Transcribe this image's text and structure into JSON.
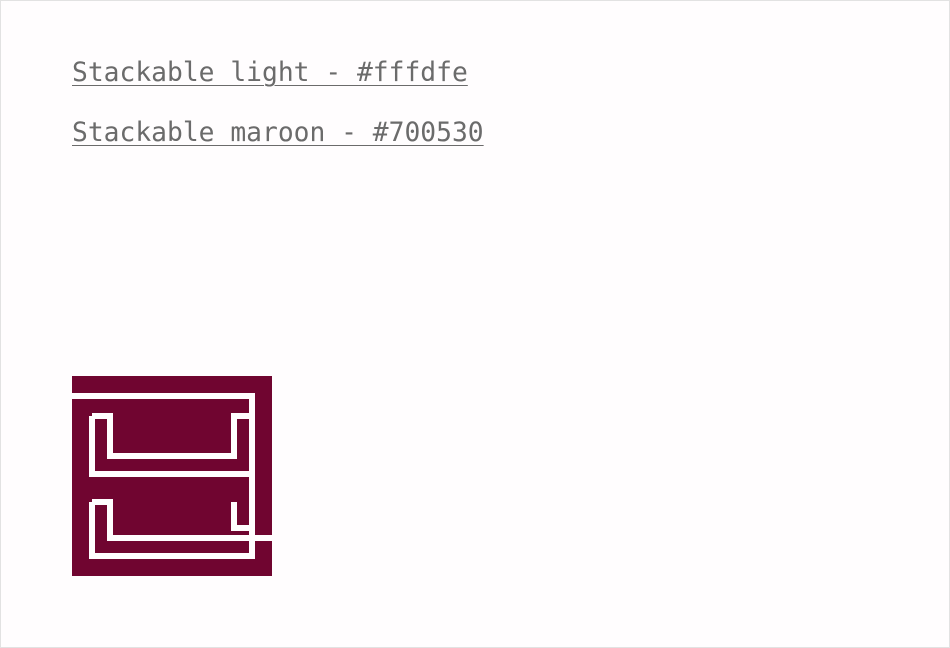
{
  "colors": {
    "light": {
      "label": "Stackable light - #fffdfe",
      "hex": "#fffdfe"
    },
    "maroon": {
      "label": "Stackable maroon - #700530",
      "hex": "#700530"
    }
  },
  "logo": {
    "icon": "stackable-s-logo-icon",
    "fill": "#700530",
    "line": "#fffdfe"
  }
}
